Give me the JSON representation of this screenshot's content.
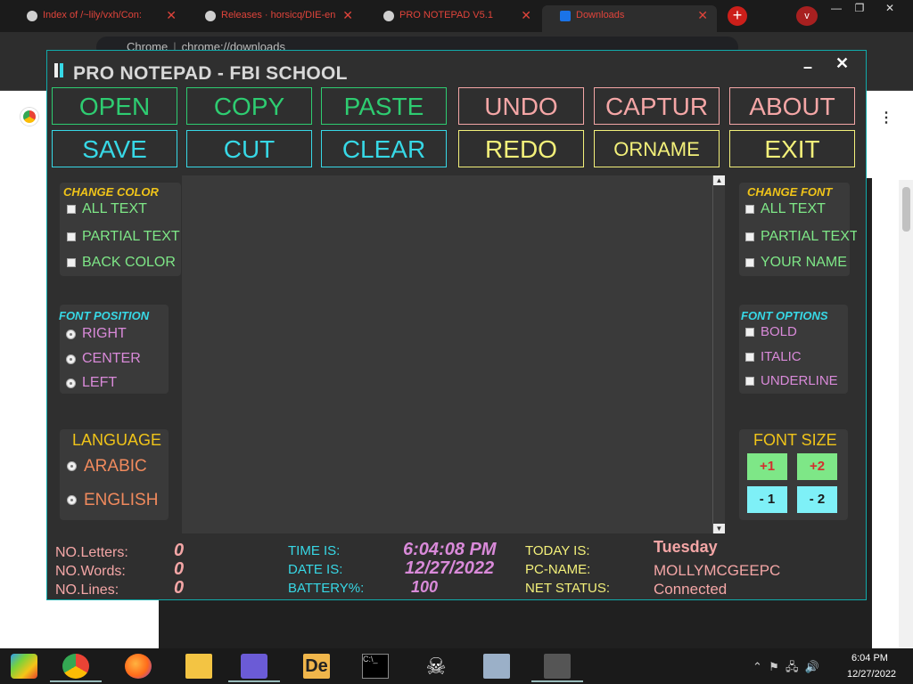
{
  "browser": {
    "tabs": [
      {
        "title": "Index of /~lily/vxh/Con:",
        "active": false
      },
      {
        "title": "Releases · horsicq/DIE-en",
        "active": false
      },
      {
        "title": "PRO NOTEPAD V5.1",
        "active": false
      },
      {
        "title": "Downloads",
        "active": true
      }
    ],
    "new_tab": "+",
    "profile": "v",
    "window_controls": [
      "—",
      "❐",
      "✕"
    ],
    "omnibox": {
      "scheme": "Chrome",
      "url": "chrome://downloads"
    }
  },
  "app": {
    "title": "PRO NOTEPAD - FBI SCHOOL",
    "minimize": "–",
    "close": "✕",
    "toolbar": {
      "row1": [
        {
          "label": "OPEN",
          "color": "#2ecc71"
        },
        {
          "label": "COPY",
          "color": "#2ecc71"
        },
        {
          "label": "PASTE",
          "color": "#2ecc71"
        },
        {
          "label": "UNDO",
          "color": "#f4a6a6"
        },
        {
          "label": "CAPTUR",
          "color": "#f4a6a6"
        },
        {
          "label": "ABOUT",
          "color": "#f4a6a6"
        }
      ],
      "row2": [
        {
          "label": "SAVE",
          "color": "#37d8e6"
        },
        {
          "label": "CUT",
          "color": "#37d8e6"
        },
        {
          "label": "CLEAR",
          "color": "#37d8e6"
        },
        {
          "label": "REDO",
          "color": "#f3f07a"
        },
        {
          "label": "ORNAME",
          "color": "#f3f07a"
        },
        {
          "label": "EXIT",
          "color": "#f3f07a"
        }
      ]
    },
    "change_color": {
      "title": "CHANGE COLOR",
      "options": [
        "ALL TEXT",
        "PARTIAL TEXT",
        "BACK COLOR"
      ]
    },
    "font_position": {
      "title": "FONT POSITION",
      "options": [
        "RIGHT",
        "CENTER",
        "LEFT"
      ]
    },
    "language": {
      "title": "LANGUAGE",
      "options": [
        "ARABIC",
        "ENGLISH"
      ]
    },
    "change_font": {
      "title": "CHANGE FONT",
      "options": [
        "ALL TEXT",
        "PARTIAL TEXT",
        "YOUR NAME"
      ]
    },
    "font_options": {
      "title": "FONT OPTIONS",
      "options": [
        "BOLD",
        "ITALIC",
        "UNDERLINE"
      ]
    },
    "font_size": {
      "title": "FONT SIZE",
      "buttons": [
        "+1",
        "+2",
        "- 1",
        "- 2"
      ]
    },
    "editor": {
      "text": ""
    },
    "status": {
      "letters_label": "NO.Letters:",
      "letters": "0",
      "words_label": "NO.Words:",
      "words": "0",
      "lines_label": "NO.Lines:",
      "lines": "0",
      "time_label": "TIME IS:",
      "time": "6:04:08 PM",
      "date_label": "DATE IS:",
      "date": "12/27/2022",
      "battery_label": "BATTERY%:",
      "battery": "100",
      "today_label": "TODAY IS:",
      "today": "Tuesday",
      "pc_label": "PC-NAME:",
      "pc": "MOLLYMCGEEPC",
      "net_label": "NET STATUS:",
      "net": "Connected"
    }
  },
  "taskbar": {
    "apps": [
      "windows-start",
      "chrome",
      "firefox",
      "file-explorer",
      "people-app",
      "detect-it-easy",
      "command-prompt",
      "skull-app",
      "monitor-app",
      "notepad-app"
    ],
    "time": "6:04 PM",
    "date": "12/27/2022"
  }
}
